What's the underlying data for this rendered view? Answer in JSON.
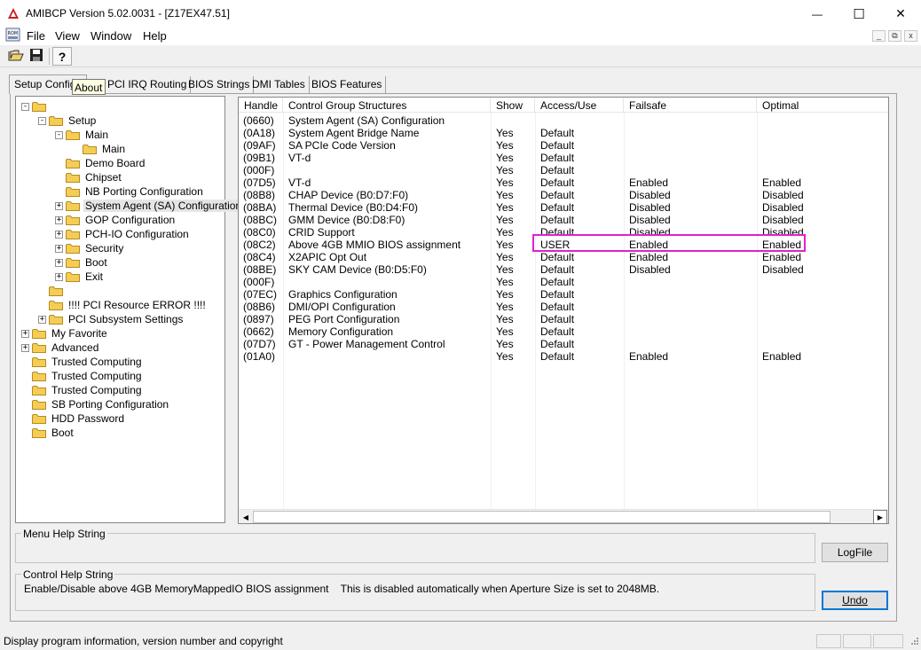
{
  "window": {
    "title": "AMIBCP Version 5.02.0031 - [Z17EX47.51]",
    "minimize_glyph": "—",
    "maximize_glyph": "☐",
    "close_glyph": "✕"
  },
  "menubar": {
    "icon_text": "ROM",
    "items": [
      "File",
      "View",
      "Window",
      "Help"
    ],
    "mdi_buttons": [
      "_",
      "⧉",
      "x"
    ]
  },
  "toolbar": {
    "icons": [
      "open-folder-icon",
      "save-icon",
      "help-icon"
    ]
  },
  "tabs": {
    "items": [
      "Setup Configu",
      "PCI IRQ Routing",
      "BIOS Strings",
      "DMI Tables",
      "BIOS Features"
    ],
    "active": 0,
    "tooltip": "About"
  },
  "tree": {
    "nodes": [
      {
        "label": "",
        "expander": "-"
      },
      {
        "label": "Setup",
        "expander": "-"
      },
      {
        "label": "Main",
        "expander": "-"
      },
      {
        "label": "Main",
        "expander": ""
      },
      {
        "label": "Demo Board",
        "expander": ""
      },
      {
        "label": "Chipset",
        "expander": ""
      },
      {
        "label": "NB Porting Configuration",
        "expander": ""
      },
      {
        "label": "System Agent (SA) Configuration",
        "expander": "+",
        "selected": true
      },
      {
        "label": "GOP Configuration",
        "expander": "+"
      },
      {
        "label": "PCH-IO Configuration",
        "expander": "+"
      },
      {
        "label": "Security",
        "expander": "+"
      },
      {
        "label": "Boot",
        "expander": "+"
      },
      {
        "label": "Exit",
        "expander": "+"
      },
      {
        "label": "",
        "expander": ""
      },
      {
        "label": "!!!! PCI Resource ERROR !!!!",
        "expander": ""
      },
      {
        "label": "PCI Subsystem Settings",
        "expander": "+"
      },
      {
        "label": "My Favorite",
        "expander": "+"
      },
      {
        "label": "Advanced",
        "expander": "+"
      },
      {
        "label": "Trusted Computing",
        "expander": ""
      },
      {
        "label": "Trusted Computing",
        "expander": ""
      },
      {
        "label": "Trusted Computing",
        "expander": ""
      },
      {
        "label": "SB Porting Configuration",
        "expander": ""
      },
      {
        "label": "HDD Password",
        "expander": ""
      },
      {
        "label": "Boot",
        "expander": ""
      }
    ]
  },
  "grid": {
    "columns": [
      "Handle",
      "Control Group Structures",
      "Show",
      "Access/Use",
      "Failsafe",
      "Optimal"
    ],
    "rows": [
      [
        "(0660)",
        "System Agent (SA) Configuration",
        "",
        "",
        "",
        ""
      ],
      [
        "(0A18)",
        "System Agent Bridge Name",
        "Yes",
        "Default",
        "",
        ""
      ],
      [
        "(09AF)",
        "SA PCIe Code Version",
        "Yes",
        "Default",
        "",
        ""
      ],
      [
        "(09B1)",
        "VT-d",
        "Yes",
        "Default",
        "",
        ""
      ],
      [
        "(000F)",
        "",
        "Yes",
        "Default",
        "",
        ""
      ],
      [
        "(07D5)",
        "VT-d",
        "Yes",
        "Default",
        "Enabled",
        "Enabled"
      ],
      [
        "(08B8)",
        "CHAP Device (B0:D7:F0)",
        "Yes",
        "Default",
        "Disabled",
        "Disabled"
      ],
      [
        "(08BA)",
        "Thermal Device (B0:D4:F0)",
        "Yes",
        "Default",
        "Disabled",
        "Disabled"
      ],
      [
        "(08BC)",
        "GMM Device (B0:D8:F0)",
        "Yes",
        "Default",
        "Disabled",
        "Disabled"
      ],
      [
        "(08C0)",
        "CRID Support",
        "Yes",
        "Default",
        "Disabled",
        "Disabled"
      ],
      [
        "(08C2)",
        "Above 4GB MMIO BIOS assignment",
        "Yes",
        "USER",
        "Enabled",
        "Enabled"
      ],
      [
        "(08C4)",
        "X2APIC Opt Out",
        "Yes",
        "Default",
        "Enabled",
        "Enabled"
      ],
      [
        "(08BE)",
        "SKY CAM Device (B0:D5:F0)",
        "Yes",
        "Default",
        "Disabled",
        "Disabled"
      ],
      [
        "(000F)",
        "",
        "Yes",
        "Default",
        "",
        ""
      ],
      [
        "(07EC)",
        "Graphics Configuration",
        "Yes",
        "Default",
        "",
        ""
      ],
      [
        "(08B6)",
        "DMI/OPI Configuration",
        "Yes",
        "Default",
        "",
        ""
      ],
      [
        "(0897)",
        "PEG Port Configuration",
        "Yes",
        "Default",
        "",
        ""
      ],
      [
        "(0662)",
        "Memory Configuration",
        "Yes",
        "Default",
        "",
        ""
      ],
      [
        "(07D7)",
        "GT - Power Management Control",
        "Yes",
        "Default",
        "",
        ""
      ],
      [
        "(01A0)",
        "",
        "Yes",
        "Default",
        "Enabled",
        "Enabled"
      ]
    ],
    "highlight_color": "#e020d0",
    "scroll_left": "◀",
    "scroll_right": "▶"
  },
  "menu_help": {
    "label": "Menu Help String",
    "text": ""
  },
  "control_help": {
    "label": "Control Help String",
    "text": "Enable/Disable above 4GB MemoryMappedIO BIOS assignment    This is disabled automatically when Aperture Size is set to 2048MB."
  },
  "buttons": {
    "logfile": "LogFile",
    "undo": "Undo"
  },
  "statusbar": {
    "text": "Display program information, version number and copyright"
  }
}
